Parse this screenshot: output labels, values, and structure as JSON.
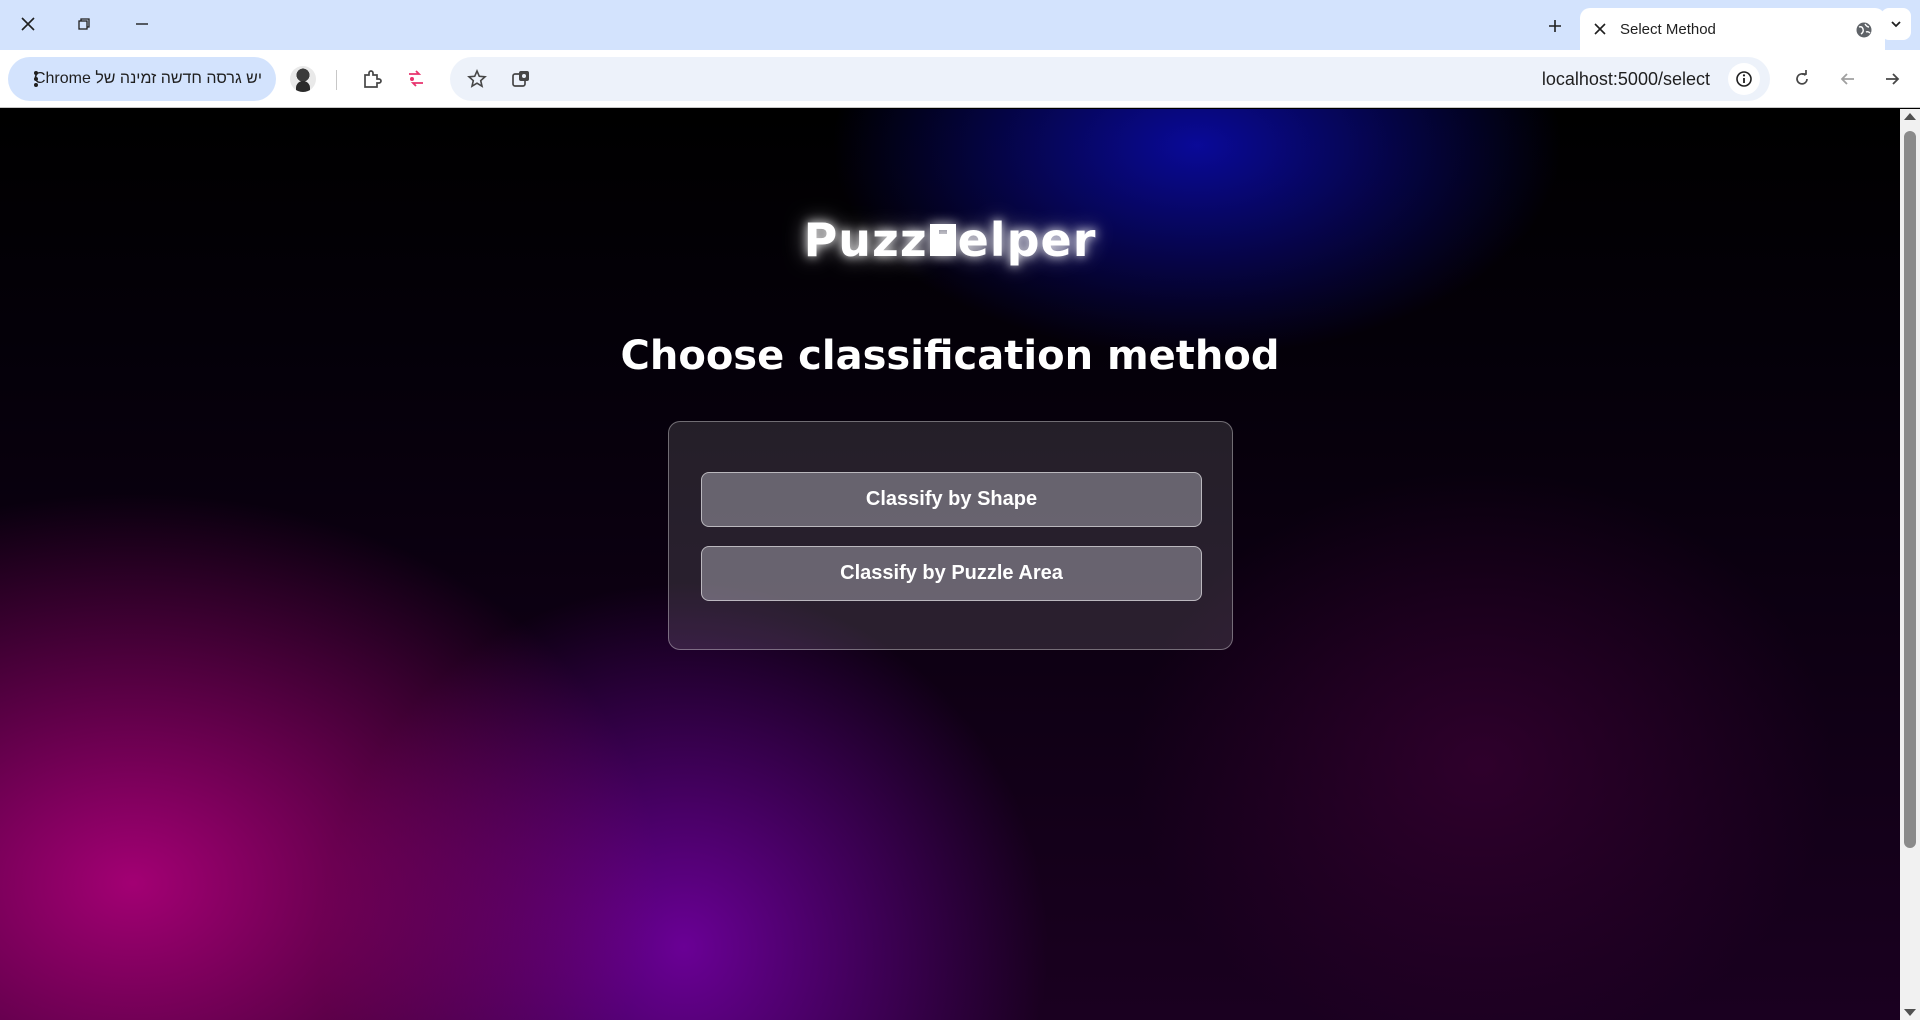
{
  "browser": {
    "tab": {
      "title": "Select Method"
    },
    "update_chip": {
      "label": "יש גרסה חדשה זמינה של Chrome"
    },
    "address": {
      "host": "localhost",
      "path": ":5000/select"
    }
  },
  "page": {
    "logo_left": "Puzz",
    "logo_right": "elper",
    "heading": "Choose classification method",
    "buttons": {
      "shape": "Classify by Shape",
      "area": "Classify by Puzzle Area"
    }
  },
  "icons": {
    "close": "close-icon",
    "restore": "restore-icon",
    "minimize": "minimize-icon",
    "new_tab": "plus-icon",
    "tab_search": "chevron-down-icon",
    "back": "arrow-left-icon",
    "forward": "arrow-right-icon",
    "reload": "reload-icon",
    "info": "info-icon",
    "bookmark": "star-icon",
    "extensions": "puzzle-icon",
    "menu": "kebab-icon",
    "globe": "globe-icon",
    "puzzle_piece": "puzzle-piece-icon"
  }
}
